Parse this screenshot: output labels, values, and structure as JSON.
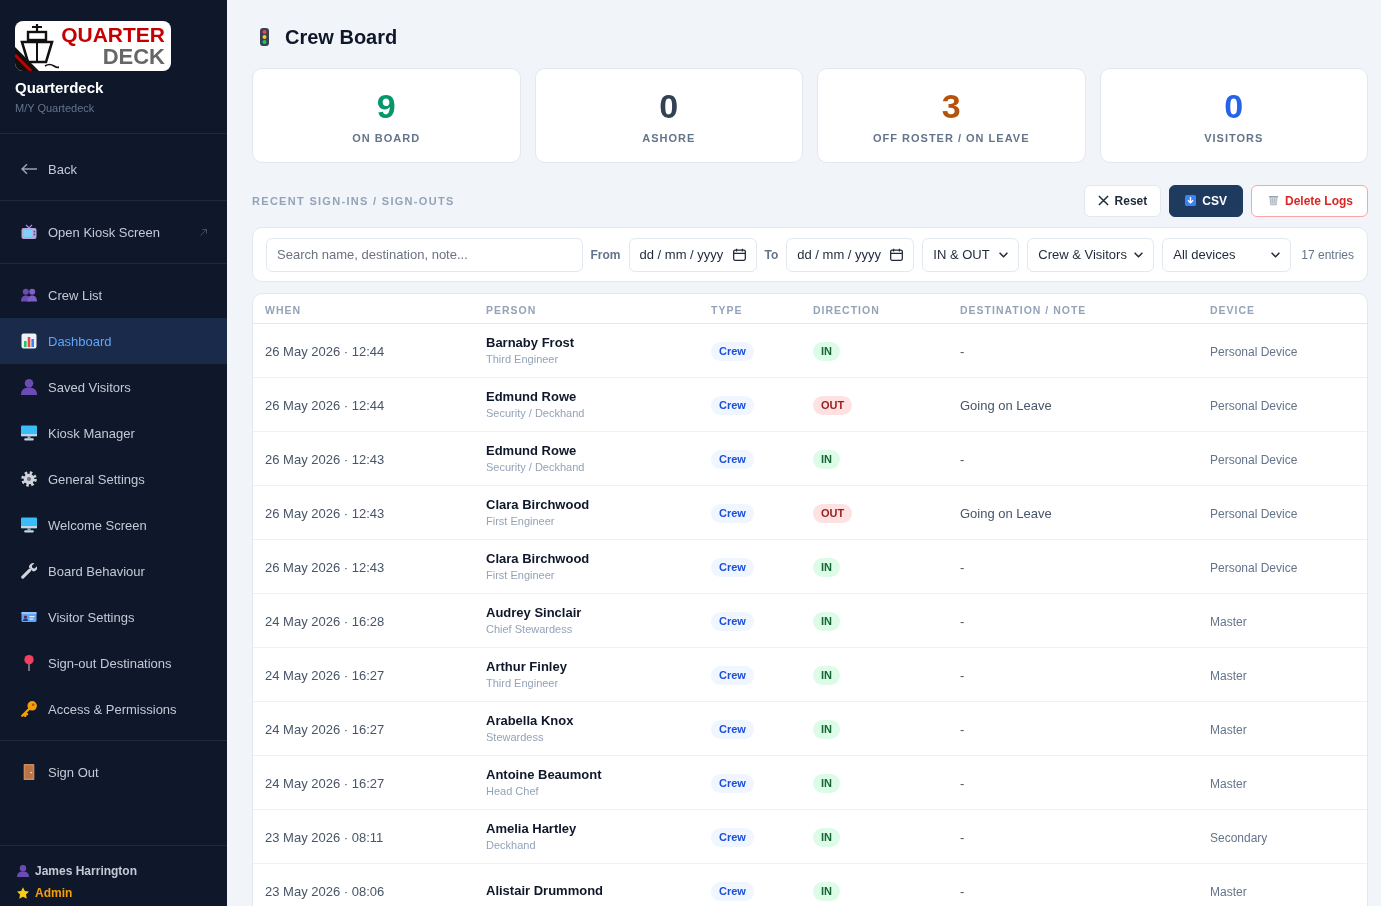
{
  "sidebar": {
    "logo": {
      "line_1": "QUARTER",
      "line_2": "DECK"
    },
    "brand": {
      "name": "Quarterdeck",
      "subtitle": "M/Y Quartedeck"
    },
    "nav_groups": [
      {
        "items": [
          {
            "label": "Back",
            "selected": false,
            "external": false
          }
        ]
      },
      {
        "items": [
          {
            "label": "Open Kiosk Screen",
            "selected": false,
            "external": true
          }
        ]
      },
      {
        "items": [
          {
            "label": "Crew List",
            "selected": false,
            "external": false
          },
          {
            "label": "Dashboard",
            "selected": true,
            "external": false
          },
          {
            "label": "Saved Visitors",
            "selected": false,
            "external": false
          },
          {
            "label": "Kiosk Manager",
            "selected": false,
            "external": false
          },
          {
            "label": "General Settings",
            "selected": false,
            "external": false
          },
          {
            "label": "Welcome Screen",
            "selected": false,
            "external": false
          },
          {
            "label": "Board Behaviour",
            "selected": false,
            "external": false
          },
          {
            "label": "Visitor Settings",
            "selected": false,
            "external": false
          },
          {
            "label": "Sign-out Destinations",
            "selected": false,
            "external": false
          },
          {
            "label": "Access & Permissions",
            "selected": false,
            "external": false
          }
        ]
      },
      {
        "items": [
          {
            "label": "Sign Out",
            "selected": false,
            "external": false
          }
        ]
      }
    ],
    "user": {
      "name": "James Harrington",
      "role": "Admin"
    }
  },
  "page": {
    "title": "Crew Board"
  },
  "stats": [
    {
      "value": "9",
      "label": "ON BOARD",
      "color": "#059669"
    },
    {
      "value": "0",
      "label": "ASHORE",
      "color": "#334155"
    },
    {
      "value": "3",
      "label": "OFF ROSTER / ON LEAVE",
      "color": "#b45309"
    },
    {
      "value": "0",
      "label": "VISITORS",
      "color": "#2563eb"
    }
  ],
  "log_section": {
    "title": "RECENT SIGN-INS / SIGN-OUTS",
    "buttons": [
      {
        "label": "Reset",
        "kind": "reset"
      },
      {
        "label": "CSV",
        "kind": "export"
      },
      {
        "label": "Delete Logs",
        "kind": "delete"
      }
    ]
  },
  "filters": {
    "search": {
      "placeholder": "Search name, destination, note..."
    },
    "date_from": {
      "label": "From",
      "placeholder": "dd / mm / yyyy"
    },
    "date_to": {
      "label": "To",
      "placeholder": "dd / mm / yyyy"
    },
    "dropdowns": [
      {
        "value": "IN & OUT"
      },
      {
        "value": "Crew & Visitors"
      },
      {
        "value": "All devices"
      }
    ],
    "entry_count": "17 entries"
  },
  "table": {
    "columns": [
      "WHEN",
      "PERSON",
      "TYPE",
      "DIRECTION",
      "DESTINATION / NOTE",
      "DEVICE"
    ],
    "rows": [
      {
        "when": "26 May 2026 · 12:44",
        "name": "Barnaby Frost",
        "role": "Third Engineer",
        "type": {
          "label": "Crew",
          "kind": "crew"
        },
        "direction": {
          "label": "IN",
          "kind": "in"
        },
        "note": "-",
        "device": "Personal Device"
      },
      {
        "when": "26 May 2026 · 12:44",
        "name": "Edmund Rowe",
        "role": "Security / Deckhand",
        "type": {
          "label": "Crew",
          "kind": "crew"
        },
        "direction": {
          "label": "OUT",
          "kind": "out"
        },
        "note": "Going on Leave",
        "device": "Personal Device"
      },
      {
        "when": "26 May 2026 · 12:43",
        "name": "Edmund Rowe",
        "role": "Security / Deckhand",
        "type": {
          "label": "Crew",
          "kind": "crew"
        },
        "direction": {
          "label": "IN",
          "kind": "in"
        },
        "note": "-",
        "device": "Personal Device"
      },
      {
        "when": "26 May 2026 · 12:43",
        "name": "Clara Birchwood",
        "role": "First Engineer",
        "type": {
          "label": "Crew",
          "kind": "crew"
        },
        "direction": {
          "label": "OUT",
          "kind": "out"
        },
        "note": "Going on Leave",
        "device": "Personal Device"
      },
      {
        "when": "26 May 2026 · 12:43",
        "name": "Clara Birchwood",
        "role": "First Engineer",
        "type": {
          "label": "Crew",
          "kind": "crew"
        },
        "direction": {
          "label": "IN",
          "kind": "in"
        },
        "note": "-",
        "device": "Personal Device"
      },
      {
        "when": "24 May 2026 · 16:28",
        "name": "Audrey Sinclair",
        "role": "Chief Stewardess",
        "type": {
          "label": "Crew",
          "kind": "crew"
        },
        "direction": {
          "label": "IN",
          "kind": "in"
        },
        "note": "-",
        "device": "Master"
      },
      {
        "when": "24 May 2026 · 16:27",
        "name": "Arthur Finley",
        "role": "Third Engineer",
        "type": {
          "label": "Crew",
          "kind": "crew"
        },
        "direction": {
          "label": "IN",
          "kind": "in"
        },
        "note": "-",
        "device": "Master"
      },
      {
        "when": "24 May 2026 · 16:27",
        "name": "Arabella Knox",
        "role": "Stewardess",
        "type": {
          "label": "Crew",
          "kind": "crew"
        },
        "direction": {
          "label": "IN",
          "kind": "in"
        },
        "note": "-",
        "device": "Master"
      },
      {
        "when": "24 May 2026 · 16:27",
        "name": "Antoine Beaumont",
        "role": "Head Chef",
        "type": {
          "label": "Crew",
          "kind": "crew"
        },
        "direction": {
          "label": "IN",
          "kind": "in"
        },
        "note": "-",
        "device": "Master"
      },
      {
        "when": "23 May 2026 · 08:11",
        "name": "Amelia Hartley",
        "role": "Deckhand",
        "type": {
          "label": "Crew",
          "kind": "crew"
        },
        "direction": {
          "label": "IN",
          "kind": "in"
        },
        "note": "-",
        "device": "Secondary"
      },
      {
        "when": "23 May 2026 · 08:06",
        "name": "Alistair Drummond",
        "type": {
          "label": "Crew",
          "kind": "crew"
        },
        "direction": {
          "label": "IN",
          "kind": "in"
        },
        "note": "-",
        "device": "Master"
      }
    ]
  }
}
